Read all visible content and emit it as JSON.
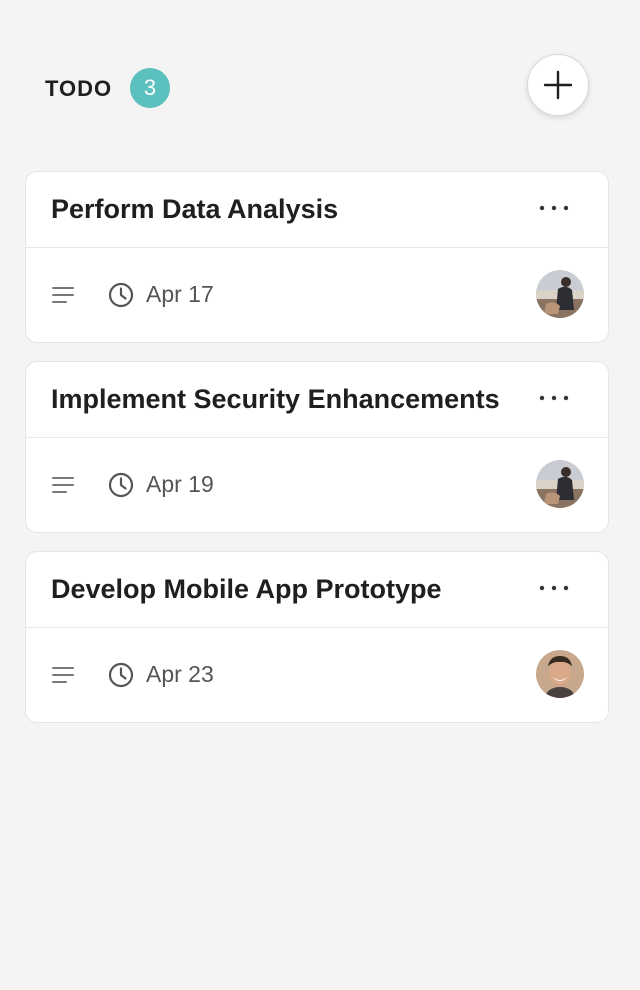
{
  "column": {
    "title": "TODO",
    "count": "3"
  },
  "colors": {
    "badge": "#5bc0be",
    "background": "#f4f4f4",
    "card": "#ffffff"
  },
  "cards": [
    {
      "title": "Perform Data Analysis",
      "due": "Apr 17",
      "avatar": "avatar-photo-person-sitting"
    },
    {
      "title": "Implement Security Enhancements",
      "due": "Apr 19",
      "avatar": "avatar-photo-person-sitting"
    },
    {
      "title": "Develop Mobile App Prototype",
      "due": "Apr 23",
      "avatar": "avatar-photo-smiling-man"
    }
  ],
  "icons": {
    "add": "plus-icon",
    "more": "ellipsis-icon",
    "description": "description-lines-icon",
    "due": "clock-icon"
  }
}
